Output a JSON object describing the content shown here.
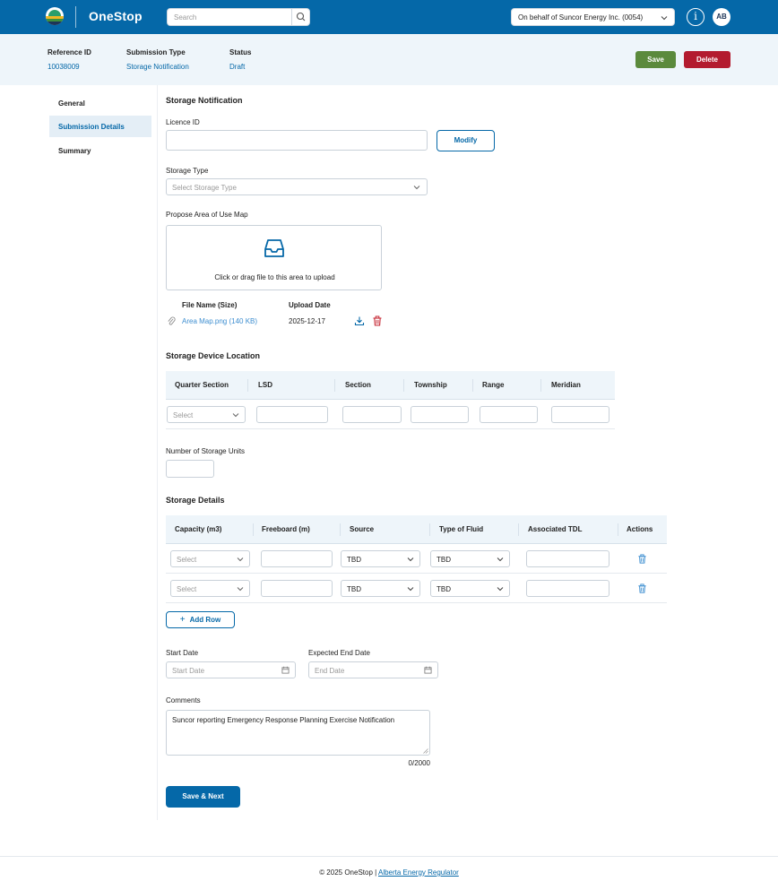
{
  "header": {
    "brand": "OneStop",
    "search_placeholder": "Search",
    "behalf": "On behalf of Suncor Energy Inc. (0054)",
    "info_glyph": "i",
    "avatar": "AB",
    "colors": {
      "primary": "#0568a8",
      "save": "#5b8a3c",
      "delete": "#b31b2f"
    }
  },
  "subheader": {
    "reference_label": "Reference ID",
    "reference_value": "10038009",
    "type_label": "Submission Type",
    "type_value": "Storage Notification",
    "status_label": "Status",
    "status_value": "Draft",
    "save": "Save",
    "delete": "Delete"
  },
  "nav": [
    {
      "label": "General"
    },
    {
      "label": "Submission Details"
    },
    {
      "label": "Summary"
    }
  ],
  "form": {
    "title": "Storage Notification",
    "licence_label": "Licence ID",
    "licence_value": "",
    "modify": "Modify",
    "storage_type_label": "Storage Type",
    "storage_type_placeholder": "Select Storage Type",
    "map_label": "Propose Area of Use Map",
    "upload_text": "Click or drag file to this area to upload",
    "files_header": {
      "name": "File Name (Size)",
      "date": "Upload Date"
    },
    "files": [
      {
        "name": "Area Map.png (140 KB)",
        "date": "2025-12-17"
      }
    ]
  },
  "location": {
    "title": "Storage Device Location",
    "columns": [
      "Quarter Section",
      "LSD",
      "Section",
      "Township",
      "Range",
      "Meridian"
    ],
    "select_placeholder": "Select"
  },
  "units": {
    "label": "Number of Storage Units",
    "value": ""
  },
  "details": {
    "title": "Storage Details",
    "columns": [
      "Capacity (m3)",
      "Freeboard (m)",
      "Source",
      "Type of Fluid",
      "Associated TDL",
      "Actions"
    ],
    "rows": [
      {
        "capacity": "Select",
        "source": "TBD",
        "fluid": "TBD"
      },
      {
        "capacity": "Select",
        "source": "TBD",
        "fluid": "TBD"
      }
    ],
    "add_row": "Add Row"
  },
  "dates": {
    "start_label": "Start Date",
    "start_placeholder": "Start Date",
    "end_label": "Expected End Date",
    "end_placeholder": "End Date"
  },
  "comments": {
    "label": "Comments",
    "value": "Suncor reporting Emergency Response Planning Exercise Notification",
    "counter": "0/2000"
  },
  "primary_action": "Save & Next",
  "footer": {
    "text": "© 2025 OneStop |",
    "link": "Alberta Energy Regulator"
  }
}
